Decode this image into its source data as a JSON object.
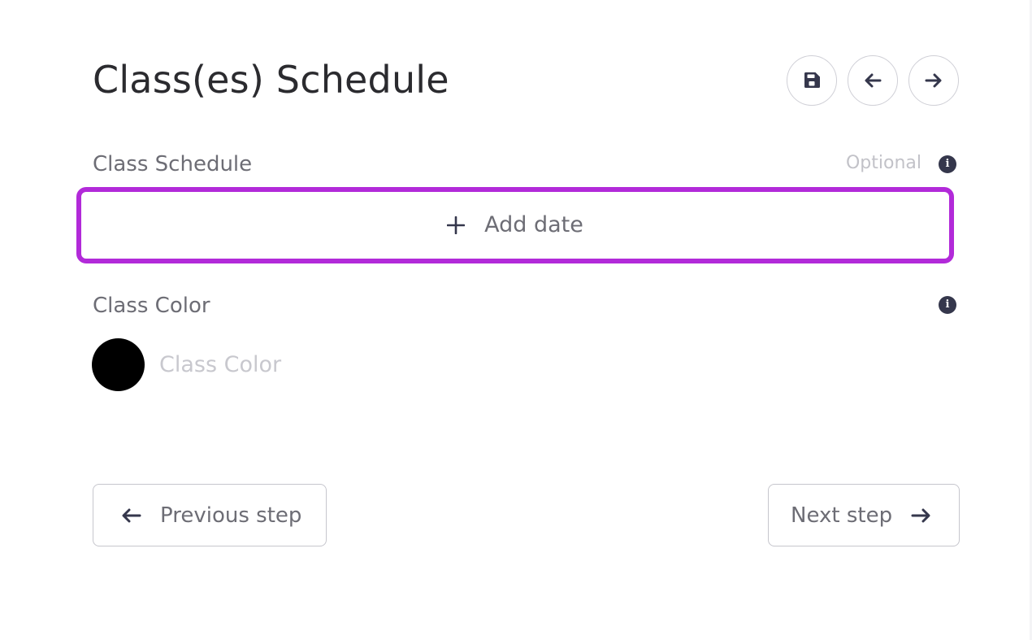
{
  "header": {
    "title": "Class(es) Schedule",
    "save_icon": "save-icon",
    "back_icon": "arrow-left-icon",
    "forward_icon": "arrow-right-icon"
  },
  "class_schedule": {
    "label": "Class Schedule",
    "optional_text": "Optional",
    "info_icon_glyph": "i",
    "add_date_label": "Add date",
    "add_date_icon": "plus-icon",
    "highlight_color": "#b22ad9"
  },
  "class_color": {
    "label": "Class Color",
    "info_icon_glyph": "i",
    "swatch_color": "#000000",
    "input_placeholder": "Class Color",
    "input_value": ""
  },
  "footer": {
    "previous_label": "Previous step",
    "next_label": "Next step"
  },
  "colors": {
    "text_dark": "#2b2b2f",
    "text_muted": "#6d6d75",
    "icon_dark": "#35374c",
    "border": "#cfcfd6"
  }
}
